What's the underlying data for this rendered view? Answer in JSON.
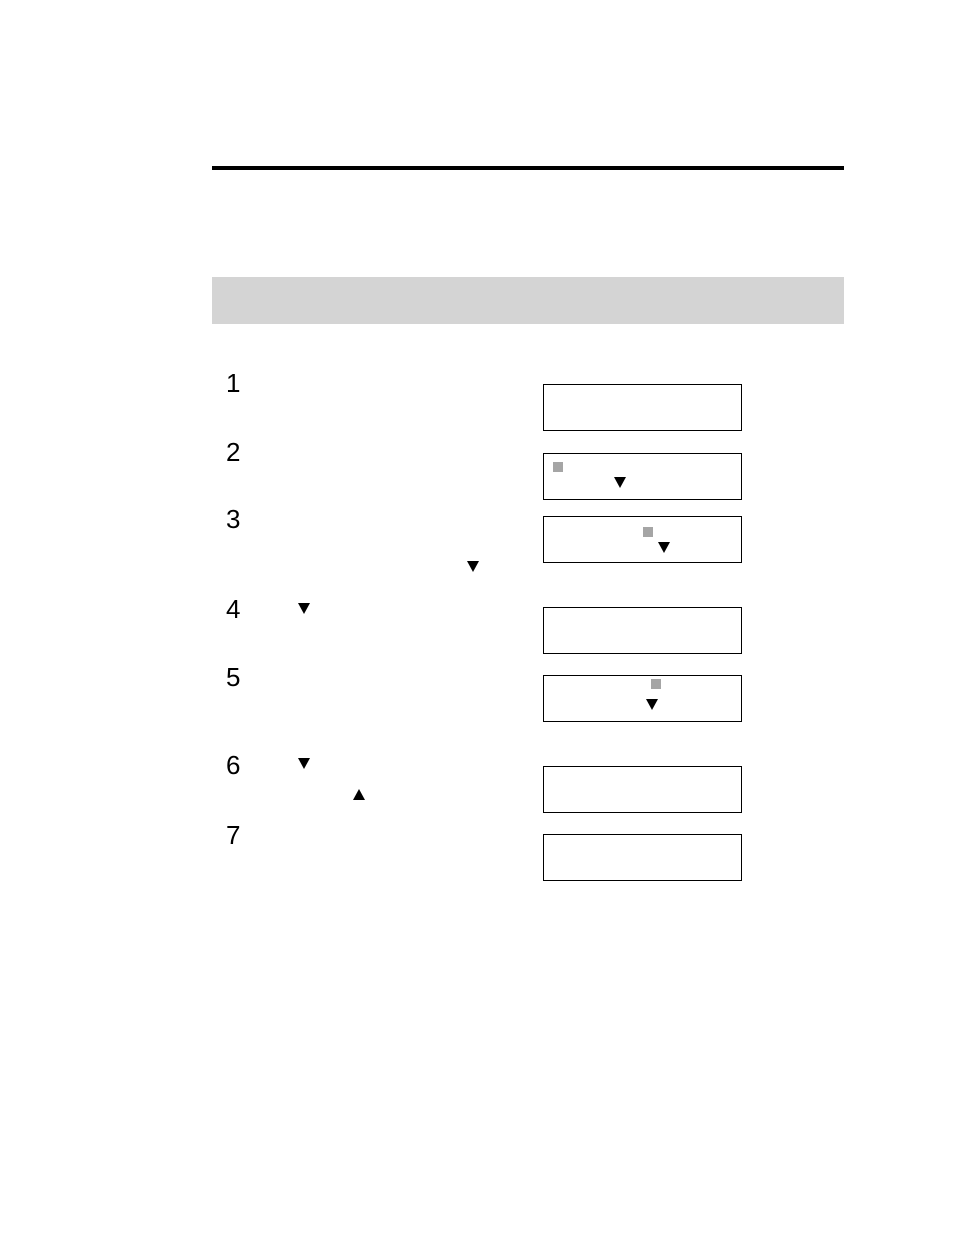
{
  "rows": {
    "r1": "1",
    "r2": "2",
    "r3": "3",
    "r4": "4",
    "r5": "5",
    "r6": "6",
    "r7": "7"
  }
}
